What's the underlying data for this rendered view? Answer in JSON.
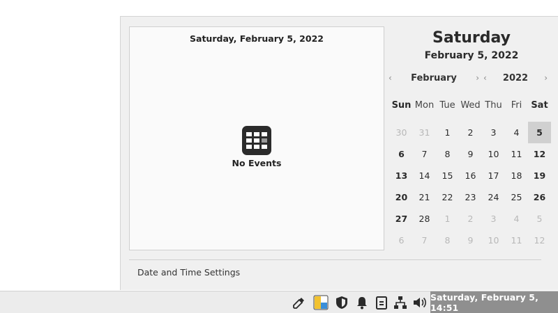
{
  "events_pane": {
    "date_heading": "Saturday, February 5, 2022",
    "empty_label": "No Events",
    "empty_icon": "calendar-grid-icon"
  },
  "calendar": {
    "weekday_title": "Saturday",
    "full_date": "February 5, 2022",
    "month": "February",
    "year": "2022",
    "prev_arrow": "‹",
    "next_arrow": "›",
    "weekdays": [
      "Sun",
      "Mon",
      "Tue",
      "Wed",
      "Thu",
      "Fri",
      "Sat"
    ],
    "weeks": [
      [
        {
          "d": "30",
          "other": true
        },
        {
          "d": "31",
          "other": true
        },
        {
          "d": "1"
        },
        {
          "d": "2"
        },
        {
          "d": "3"
        },
        {
          "d": "4"
        },
        {
          "d": "5",
          "today": true
        }
      ],
      [
        {
          "d": "6"
        },
        {
          "d": "7"
        },
        {
          "d": "8"
        },
        {
          "d": "9"
        },
        {
          "d": "10"
        },
        {
          "d": "11"
        },
        {
          "d": "12"
        }
      ],
      [
        {
          "d": "13"
        },
        {
          "d": "14"
        },
        {
          "d": "15"
        },
        {
          "d": "16"
        },
        {
          "d": "17"
        },
        {
          "d": "18"
        },
        {
          "d": "19"
        }
      ],
      [
        {
          "d": "20"
        },
        {
          "d": "21"
        },
        {
          "d": "22"
        },
        {
          "d": "23"
        },
        {
          "d": "24"
        },
        {
          "d": "25"
        },
        {
          "d": "26"
        }
      ],
      [
        {
          "d": "27"
        },
        {
          "d": "28"
        },
        {
          "d": "1",
          "other": true
        },
        {
          "d": "2",
          "other": true
        },
        {
          "d": "3",
          "other": true
        },
        {
          "d": "4",
          "other": true
        },
        {
          "d": "5",
          "other": true
        }
      ],
      [
        {
          "d": "6",
          "other": true
        },
        {
          "d": "7",
          "other": true
        },
        {
          "d": "8",
          "other": true
        },
        {
          "d": "9",
          "other": true
        },
        {
          "d": "10",
          "other": true
        },
        {
          "d": "11",
          "other": true
        },
        {
          "d": "12",
          "other": true
        }
      ]
    ],
    "settings_link": "Date and Time Settings"
  },
  "panel": {
    "tray_icons": [
      "color-picker-icon",
      "workspace-switcher-icon",
      "shield-icon",
      "notification-bell-icon",
      "clipboard-icon",
      "network-icon",
      "volume-icon"
    ],
    "clock": "Saturday, February  5, 14:51",
    "colors": {
      "clock_bg": "#8f8f8f",
      "today_bg": "#d0d0d0"
    }
  }
}
